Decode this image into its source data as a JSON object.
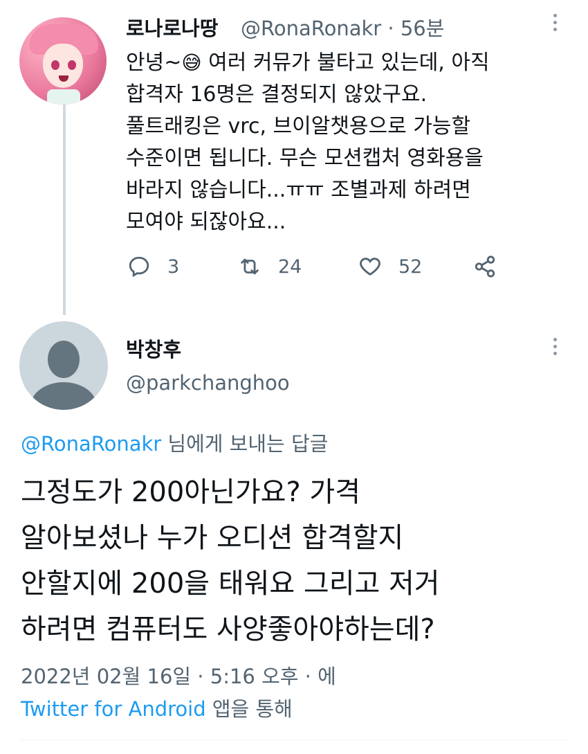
{
  "original_tweet": {
    "display_name": "로나로나땅",
    "handle": "@RonaRonakr",
    "separator": "·",
    "time_ago": "56분",
    "text_lines": [
      "안녕~",
      "여러 커뮤가 불타고 있는데, 아직",
      "합격자 16명은 결정되지 않았구요.",
      "풀트래킹은 vrc, 브이알챗용으로 가능할",
      "수준이면 됩니다. 무슨 모션캡처 영화용을",
      "바라지 않습니다...ㅠㅠ 조별과제 하려면",
      "모여야 되잖아요..."
    ],
    "emoji": "😅",
    "stats": {
      "replies": "3",
      "retweets": "24",
      "likes": "52"
    },
    "icons": [
      "reply-icon",
      "retweet-icon",
      "like-icon",
      "share-icon",
      "more-icon"
    ]
  },
  "reply_tweet": {
    "display_name": "박창후",
    "handle": "@parkchanghoo",
    "replying_to_handle": "@RonaRonakr",
    "replying_to_suffix": "님에게 보내는 답글",
    "text_lines": [
      "그정도가 200아닌가요? 가격",
      "알아보셨나 누가 오디션 합격할지",
      "안할지에 200을 태워요 그리고 저거",
      "하려면 컴퓨터도 사양좋아야하는데?"
    ],
    "timestamp": "2022년 02월 16일 · 5:16 오후 · 에",
    "source_app": "Twitter for Android",
    "source_suffix": "앱을 통해"
  },
  "colors": {
    "accent": "#1d9bf0",
    "secondary_text": "#536471",
    "primary_text": "#0f1419",
    "thread_line": "#cfd9de"
  }
}
